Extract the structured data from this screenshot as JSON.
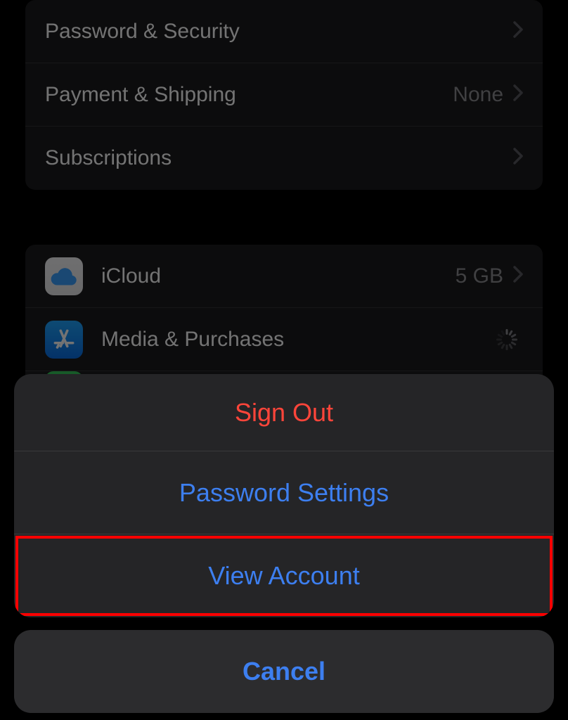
{
  "settings": {
    "group1": [
      {
        "label": "Password & Security",
        "value": ""
      },
      {
        "label": "Payment & Shipping",
        "value": "None"
      },
      {
        "label": "Subscriptions",
        "value": ""
      }
    ],
    "group2": [
      {
        "label": "iCloud",
        "value": "5 GB",
        "icon": "icloud"
      },
      {
        "label": "Media & Purchases",
        "value": "",
        "icon": "appstore",
        "loading": true
      }
    ]
  },
  "actionSheet": {
    "items": [
      {
        "label": "Sign Out",
        "style": "destructive"
      },
      {
        "label": "Password Settings",
        "style": "default"
      },
      {
        "label": "View Account",
        "style": "default",
        "highlighted": true
      }
    ],
    "cancel": "Cancel"
  }
}
